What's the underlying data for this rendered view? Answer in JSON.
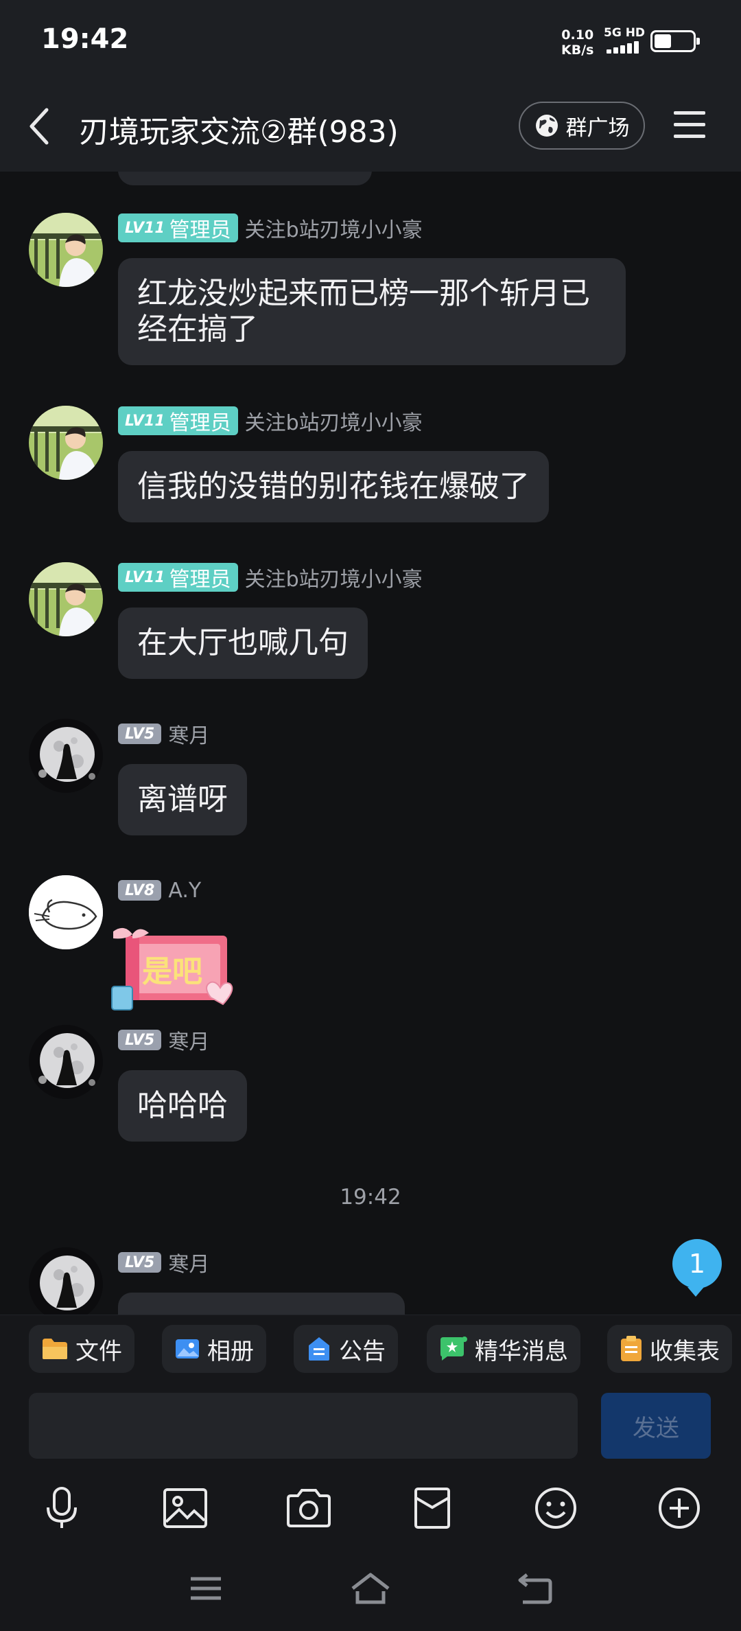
{
  "status": {
    "time": "19:42",
    "net_speed": "0.10",
    "net_unit": "KB/s",
    "network": "5G HD",
    "battery_level": 0.45
  },
  "header": {
    "title": "刃境玩家交流②群(983)",
    "plaza_label": "群广场"
  },
  "messages": [
    {
      "level": "LV11",
      "role": "管理员",
      "nickname": "关注b站刃境小小豪",
      "avatar": "boy-on-balcony",
      "text_lines": [
        "红龙没炒起来而已榜一那个斩月已",
        "经在搞了"
      ]
    },
    {
      "level": "LV11",
      "role": "管理员",
      "nickname": "关注b站刃境小小豪",
      "avatar": "boy-on-balcony",
      "text": "信我的没错的别花钱在爆破了"
    },
    {
      "level": "LV11",
      "role": "管理员",
      "nickname": "关注b站刃境小小豪",
      "avatar": "boy-on-balcony",
      "text": "在大厅也喊几句"
    },
    {
      "level": "LV5",
      "nickname": "寒月",
      "avatar": "moon-girl",
      "text": "离谱呀"
    },
    {
      "level": "LV8",
      "nickname": "A.Y",
      "avatar": "cartoon-rabbit",
      "sticker_text": "是吧"
    },
    {
      "level": "LV5",
      "nickname": "寒月",
      "avatar": "moon-girl",
      "text": "哈哈哈"
    },
    {
      "level": "LV5",
      "nickname": "寒月",
      "avatar": "moon-girl"
    }
  ],
  "time_separator": "19:42",
  "unread_count": "1",
  "quick_actions": [
    {
      "label": "文件",
      "icon": "folder-icon",
      "color": "#f5b53f"
    },
    {
      "label": "相册",
      "icon": "album-icon",
      "color": "#3d8ff2"
    },
    {
      "label": "公告",
      "icon": "announcement-icon",
      "color": "#3d8ff2"
    },
    {
      "label": "精华消息",
      "icon": "essence-icon",
      "color": "#3cc36b"
    },
    {
      "label": "收集表",
      "icon": "clipboard-icon",
      "color": "#f5b53f"
    }
  ],
  "composer": {
    "input_value": "",
    "send_label": "发送"
  },
  "toolbar": [
    "voice-icon",
    "image-icon",
    "camera-icon",
    "red-packet-icon",
    "emoji-icon",
    "plus-icon"
  ],
  "navbar": [
    "recents-icon",
    "home-icon",
    "back-icon"
  ],
  "colors": {
    "admin_tag": "#5ecfc4",
    "bubble": "#2a2c31",
    "send_button": "#13376b",
    "unread_badge": "#3fb3ef"
  }
}
